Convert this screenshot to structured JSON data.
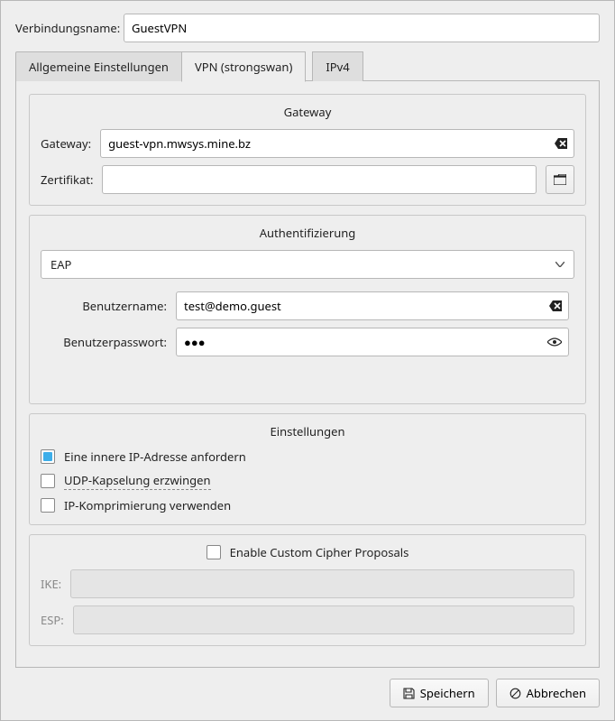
{
  "header": {
    "connection_name_label": "Verbindungsname:",
    "connection_name_value": "GuestVPN"
  },
  "tabs": {
    "general": "Allgemeine Einstellungen",
    "vpn": "VPN (strongswan)",
    "ipv4": "IPv4",
    "active_index": 1
  },
  "gateway": {
    "title": "Gateway",
    "gateway_label": "Gateway:",
    "gateway_value": "guest-vpn.mwsys.mine.bz",
    "cert_label": "Zertifikat:",
    "cert_value": ""
  },
  "auth": {
    "title": "Authentifizierung",
    "method": "EAP",
    "username_label": "Benutzername:",
    "username_value": "test@demo.guest",
    "password_label": "Benutzerpasswort:",
    "password_display": "●●●"
  },
  "settings": {
    "title": "Einstellungen",
    "items": [
      {
        "label": "Eine innere IP-Adresse anfordern",
        "checked": true,
        "underline": false
      },
      {
        "label": "UDP-Kapselung erzwingen",
        "checked": false,
        "underline": true
      },
      {
        "label": "IP-Komprimierung verwenden",
        "checked": false,
        "underline": false
      }
    ]
  },
  "cipher": {
    "enable_label": "Enable Custom Cipher Proposals",
    "enabled": false,
    "ike_label": "IKE:",
    "esp_label": "ESP:"
  },
  "buttons": {
    "save": "Speichern",
    "cancel": "Abbrechen"
  }
}
